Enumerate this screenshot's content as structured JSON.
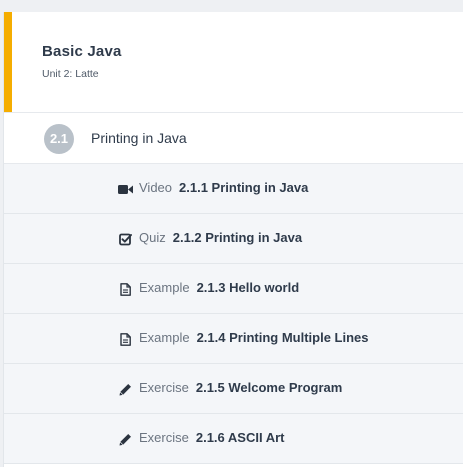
{
  "colors": {
    "accent": "#f5ad00",
    "badge": "#b9c1c9",
    "icon": "#2b3440"
  },
  "unit": {
    "title": "Basic Java",
    "subtitle": "Unit 2: Latte"
  },
  "lesson": {
    "number": "2.1",
    "title": "Printing in Java"
  },
  "items": [
    {
      "icon": "video-camera-icon",
      "type": "Video",
      "name": "2.1.1 Printing in Java"
    },
    {
      "icon": "checkbox-icon",
      "type": "Quiz",
      "name": "2.1.2 Printing in Java"
    },
    {
      "icon": "document-icon",
      "type": "Example",
      "name": "2.1.3 Hello world"
    },
    {
      "icon": "document-icon",
      "type": "Example",
      "name": "2.1.4 Printing Multiple Lines"
    },
    {
      "icon": "pencil-icon",
      "type": "Exercise",
      "name": "2.1.5 Welcome Program"
    },
    {
      "icon": "pencil-icon",
      "type": "Exercise",
      "name": "2.1.6 ASCII Art"
    }
  ]
}
